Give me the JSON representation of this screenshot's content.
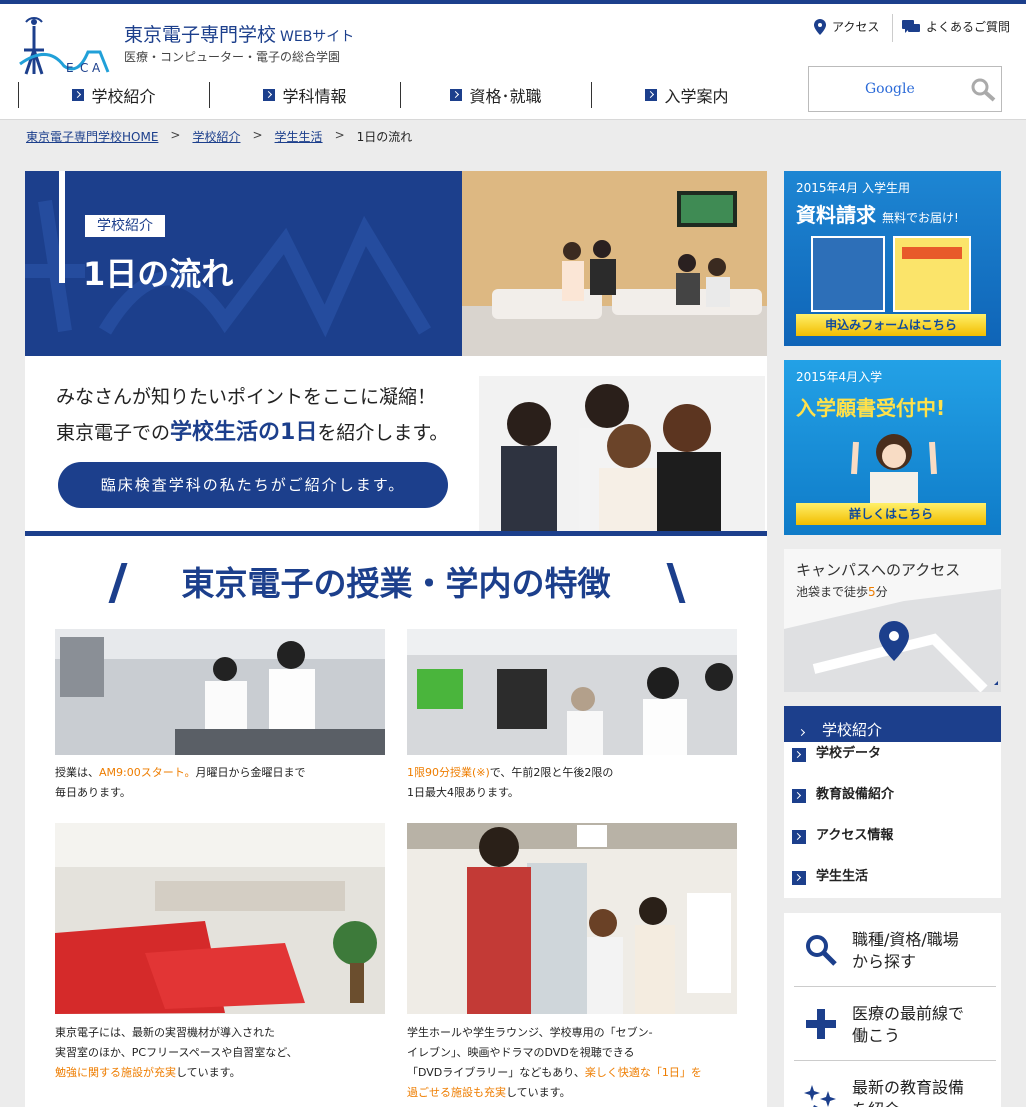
{
  "header": {
    "logo_text": "TOKYO ELECTRONICS COLLEGE",
    "site_name": "東京電子専門学校",
    "site_name_sub": "WEBサイト",
    "tagline": "医療・コンピューター・電子の総合学園",
    "access_label": "アクセス",
    "faq_label": "よくあるご質問",
    "search_brand": "Google"
  },
  "nav": [
    "学校紹介",
    "学科情報",
    "資格･就職",
    "入学案内"
  ],
  "breadcrumb": [
    "東京電子専門学校HOME",
    "学校紹介",
    "学生生活",
    "1日の流れ"
  ],
  "hero": {
    "tag": "学校紹介",
    "title": "1日の流れ"
  },
  "intro": {
    "line1": "みなさんが知りたいポイントをここに凝縮！",
    "line2_pre": "東京電子での",
    "line2_strong": "学校生活の1日",
    "line2_post": "を紹介します。",
    "pill": "臨床検査学科の私たちがご紹介します。"
  },
  "features": {
    "heading": "東京電子の授業・学内の特徴",
    "cards": [
      {
        "l1a": "授業は、",
        "l1b": "AM9:00スタート。",
        "l1c": "月曜日から金曜日まで",
        "l2": "毎日あります。"
      },
      {
        "l1a": "1限90分授業(※)",
        "l1b": "で、午前2限と午後2限の",
        "l2": "1日最大4限あります。"
      },
      {
        "l1": "東京電子には、最新の実習機材が導入された",
        "l2": "実習室のほか、PCフリースペースや自習室など、",
        "l3a": "勉強に関する施設が充実",
        "l3b": "しています。"
      },
      {
        "l1": "学生ホールや学生ラウンジ、学校専用の「セブン-",
        "l2": "イレブン」、映画やドラマのDVDを視聴できる",
        "l3a": "「DVDライブラリー」などもあり、",
        "l3b": "楽しく快適な「1日」を",
        "l4a": "過ごせる施設も充実",
        "l4b": "しています。"
      }
    ]
  },
  "sidebar": {
    "banner1": {
      "l1": "2015年4月 入学生用",
      "l2": "資料請求",
      "l2sub": "無料でお届け!",
      "button": "申込みフォームはこちら"
    },
    "banner2": {
      "l1": "2015年4月入学",
      "l2": "入学願書受付中!",
      "button": "詳しくはこちら"
    },
    "campus": {
      "title": "キャンパスへのアクセス",
      "sub_pre": "池袋まで徒歩",
      "sub_num": "5",
      "sub_post": "分"
    },
    "subnav": {
      "head": "学校紹介",
      "items": [
        "学校データ",
        "教育設備紹介",
        "アクセス情報",
        "学生生活"
      ]
    },
    "links": [
      {
        "l1": "職種/資格/職場",
        "l2": "から探す"
      },
      {
        "l1": "医療の最前線で",
        "l2": "働こう"
      },
      {
        "l1": "最新の教育設備",
        "l2": "を紹介"
      }
    ]
  },
  "colors": {
    "brand": "#1c3f8c",
    "accent": "#ee7d00",
    "banner_button": "#f7d21c"
  }
}
